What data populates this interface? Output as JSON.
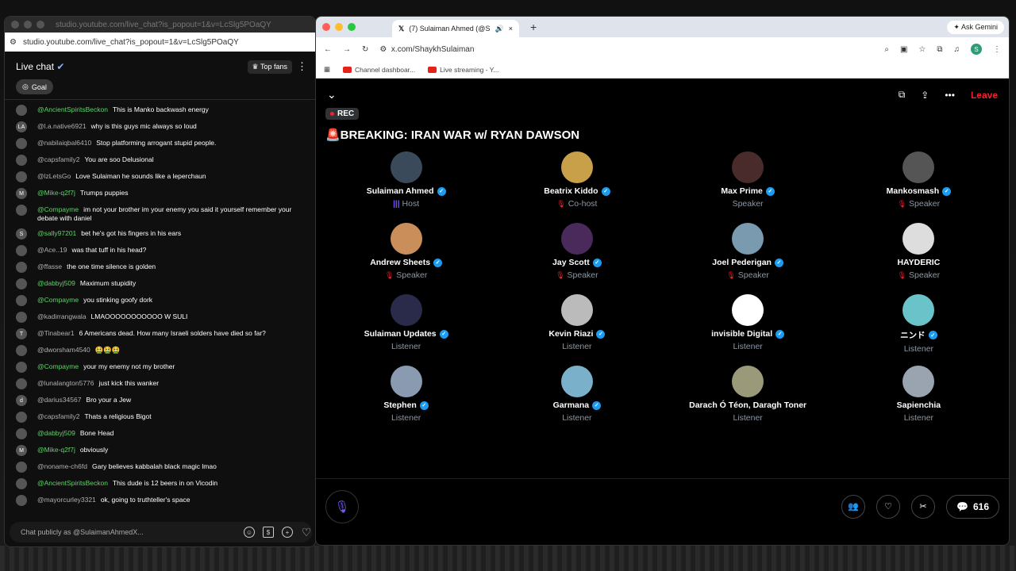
{
  "left": {
    "window_title": "studio.youtube.com/live_chat?is_popout=1&v=LcSlg5POaQY",
    "url": "studio.youtube.com/live_chat?is_popout=1&v=LcSlg5POaQY",
    "header_title": "Live chat",
    "top_fans": "Top fans",
    "goal": "Goal",
    "input_placeholder": "Chat publicly as @SulaimanAhmedX...",
    "messages": [
      {
        "user": "@AncientSpiritsBeckon",
        "text": "This is Manko backwash energy",
        "green": true,
        "av": ""
      },
      {
        "user": "@l.a.native6921",
        "text": "why is this guys mic always so loud",
        "green": false,
        "av": "LA"
      },
      {
        "user": "@nabilaiqbal6410",
        "text": "Stop platforming arrogant stupid people.",
        "green": false,
        "av": ""
      },
      {
        "user": "@capsfamily2",
        "text": "You are soo Delusional",
        "green": false,
        "av": ""
      },
      {
        "user": "@lzLetsGo",
        "text": "Love Sulaiman he sounds like a leperchaun",
        "green": false,
        "av": ""
      },
      {
        "user": "@Mike-q2f7j",
        "text": "Trumps puppies",
        "green": true,
        "av": "M"
      },
      {
        "user": "@Compayme",
        "text": "im not your brother im your enemy you said it yourself remember your debate with daniel",
        "green": true,
        "av": ""
      },
      {
        "user": "@sally97201",
        "text": "bet he's got his fingers in his ears",
        "green": true,
        "av": "S"
      },
      {
        "user": "@Ace..19",
        "text": "was that tuff in his head?",
        "green": false,
        "av": ""
      },
      {
        "user": "@ffasse",
        "text": "the one time silence is golden",
        "green": false,
        "av": ""
      },
      {
        "user": "@dabbyj509",
        "text": "Maximum stupidity",
        "green": true,
        "av": ""
      },
      {
        "user": "@Compayme",
        "text": "you stinking goofy dork",
        "green": true,
        "av": ""
      },
      {
        "user": "@kadirrangwala",
        "text": "LMAOOOOOOOOOOO W SULI",
        "green": false,
        "av": ""
      },
      {
        "user": "@Tinabear1",
        "text": "6 Americans dead. How many Israeli solders have died so far?",
        "green": false,
        "av": "T"
      },
      {
        "user": "@dworsham4540",
        "text": "🤮🤮🤮",
        "green": false,
        "av": ""
      },
      {
        "user": "@Compayme",
        "text": "your my enemy not my brother",
        "green": true,
        "av": ""
      },
      {
        "user": "@lunalangton5776",
        "text": "just kick this wanker",
        "green": false,
        "av": ""
      },
      {
        "user": "@darius34567",
        "text": "Bro your a Jew",
        "green": false,
        "av": "d"
      },
      {
        "user": "@capsfamily2",
        "text": "Thats a religious Bigot",
        "green": false,
        "av": ""
      },
      {
        "user": "@dabbyj509",
        "text": "Bone Head",
        "green": true,
        "av": ""
      },
      {
        "user": "@Mike-q2f7j",
        "text": "obviously",
        "green": true,
        "av": "M"
      },
      {
        "user": "@noname-ch6fd",
        "text": "Gary believes kabbalah black magic lmao",
        "green": false,
        "av": ""
      },
      {
        "user": "@AncientSpiritsBeckon",
        "text": "This dude is 12 beers in on Vicodin",
        "green": true,
        "av": ""
      },
      {
        "user": "@mayorcurley3321",
        "text": "ok, going to truthteller's space",
        "green": false,
        "av": ""
      }
    ]
  },
  "right": {
    "tab_title": "(7) Sulaiman Ahmed (@S",
    "ask_gemini": "Ask Gemini",
    "url": "x.com/ShaykhSulaiman",
    "bookmarks": [
      "Channel dashboar...",
      "Live streaming - Y..."
    ],
    "leave": "Leave",
    "rec": "REC",
    "title": "🚨BREAKING: IRAN WAR w/ RYAN DAWSON",
    "count": "616",
    "participants": [
      {
        "name": "Sulaiman Ahmed",
        "role": "Host",
        "verified": true,
        "icon": "bars"
      },
      {
        "name": "Beatrix Kiddo",
        "role": "Co-host",
        "verified": true,
        "icon": "muted"
      },
      {
        "name": "Max Prime",
        "role": "Speaker",
        "verified": true,
        "icon": "none"
      },
      {
        "name": "Mankosmash",
        "role": "Speaker",
        "verified": true,
        "icon": "muted"
      },
      {
        "name": "Andrew Sheets",
        "role": "Speaker",
        "verified": true,
        "icon": "muted"
      },
      {
        "name": "Jay Scott",
        "role": "Speaker",
        "verified": true,
        "icon": "muted"
      },
      {
        "name": "Joel Pederigan",
        "role": "Speaker",
        "verified": true,
        "icon": "muted"
      },
      {
        "name": "HAYDERIC",
        "role": "Speaker",
        "verified": false,
        "icon": "muted"
      },
      {
        "name": "Sulaiman Updates",
        "role": "Listener",
        "verified": true,
        "icon": "none"
      },
      {
        "name": "Kevin Riazi",
        "role": "Listener",
        "verified": true,
        "icon": "none"
      },
      {
        "name": "invisible Digital",
        "role": "Listener",
        "verified": true,
        "icon": "none"
      },
      {
        "name": "ニンド",
        "role": "Listener",
        "verified": true,
        "icon": "none"
      },
      {
        "name": "Stephen",
        "role": "Listener",
        "verified": true,
        "icon": "none"
      },
      {
        "name": "Garmana",
        "role": "Listener",
        "verified": true,
        "icon": "none"
      },
      {
        "name": "Darach Ó Téon, Daragh Toner",
        "role": "Listener",
        "verified": false,
        "icon": "none"
      },
      {
        "name": "Sapienchia",
        "role": "Listener",
        "verified": false,
        "icon": "none"
      }
    ]
  }
}
